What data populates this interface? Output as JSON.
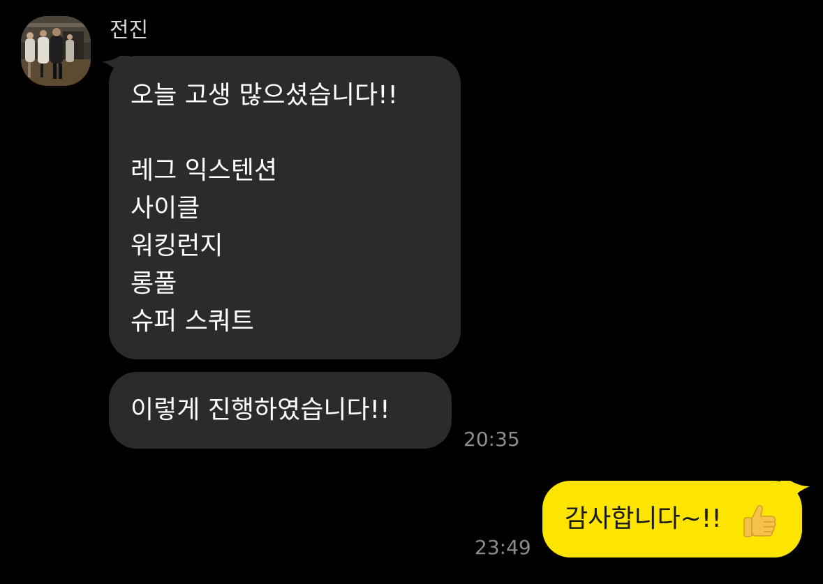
{
  "chat": {
    "incoming": {
      "sender_name": "전진",
      "avatar_icon": "gym-photo-avatar",
      "message_1_lines": [
        "오늘 고생 많으셨습니다!!",
        "",
        "레그 익스텐션",
        "사이클",
        "워킹런지",
        "롱풀",
        "슈퍼 스쿼트"
      ],
      "message_2": "이렇게 진행하였습니다!!",
      "time": "20:35",
      "bubble_color": "#2b2b2b"
    },
    "outgoing": {
      "message": "감사합니다~!!",
      "emoji_icon": "thumbs-up-icon",
      "time": "23:49",
      "bubble_color": "#fee500"
    },
    "background_color": "#000000"
  }
}
